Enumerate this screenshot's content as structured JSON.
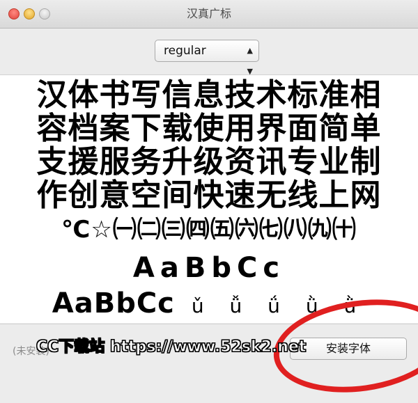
{
  "window": {
    "title": "汉真广标",
    "traffic_lights": [
      "close",
      "minimize",
      "zoom"
    ]
  },
  "style_select": {
    "value": "regular",
    "icon": "up-down-arrows-icon"
  },
  "preview": {
    "han_lines": [
      "汉体书写信息技术标准相",
      "容档案下载使用界面简单",
      "支援服务升级资讯专业制",
      "作创意空间快速无线上网"
    ],
    "symbols": "℃☆㈠㈡㈢㈣㈤㈥㈦㈧㈨㈩",
    "latin_line1": "AaBbCc",
    "latin_line2": "AaBbCc",
    "pinyin": "ǔ ǚ ǘ ǜ ǜ"
  },
  "footer": {
    "status": "(未安装)",
    "install_button": "安装字体"
  },
  "watermark": "CC下载站 https://www.52sk2.net",
  "colors": {
    "annotation_circle": "#e02020"
  }
}
